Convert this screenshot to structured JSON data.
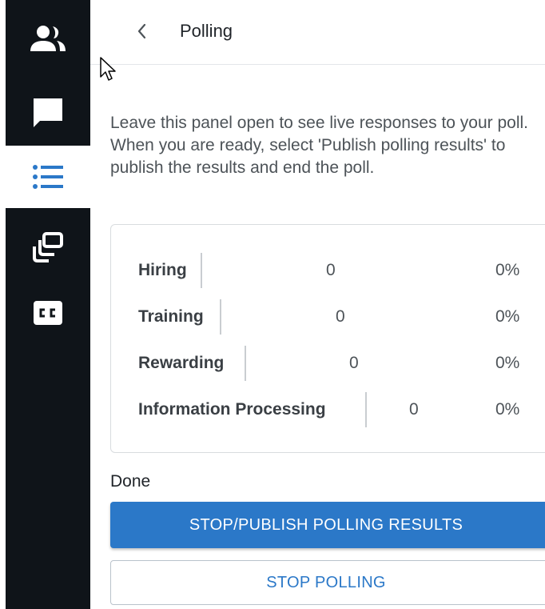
{
  "rail": {
    "items": [
      {
        "icon": "participants-icon",
        "active": false
      },
      {
        "icon": "chat-icon",
        "active": false
      },
      {
        "icon": "polling-list-icon",
        "active": true
      },
      {
        "icon": "breakout-rooms-icon",
        "active": false
      },
      {
        "icon": "closed-captions-icon",
        "active": false
      }
    ]
  },
  "header": {
    "back_icon": "chevron-left-icon",
    "title": "Polling"
  },
  "info": {
    "text": "Leave this panel open to see live responses to your poll. When you are ready, select 'Publish polling results' to publish the results and end the poll."
  },
  "results": {
    "options": [
      {
        "label": "Hiring",
        "count": "0",
        "percent": "0%"
      },
      {
        "label": "Training",
        "count": "0",
        "percent": "0%"
      },
      {
        "label": "Rewarding",
        "count": "0",
        "percent": "0%"
      },
      {
        "label": "Information Processing",
        "count": "0",
        "percent": "0%"
      }
    ]
  },
  "status": {
    "label": "Done"
  },
  "actions": {
    "publish_label": "STOP/PUBLISH POLLING RESULTS",
    "stop_label": "STOP POLLING"
  },
  "colors": {
    "rail_bg": "#0f1419",
    "accent": "#2b78c8",
    "text_primary": "#1f2328",
    "text_secondary": "#4d5358"
  }
}
